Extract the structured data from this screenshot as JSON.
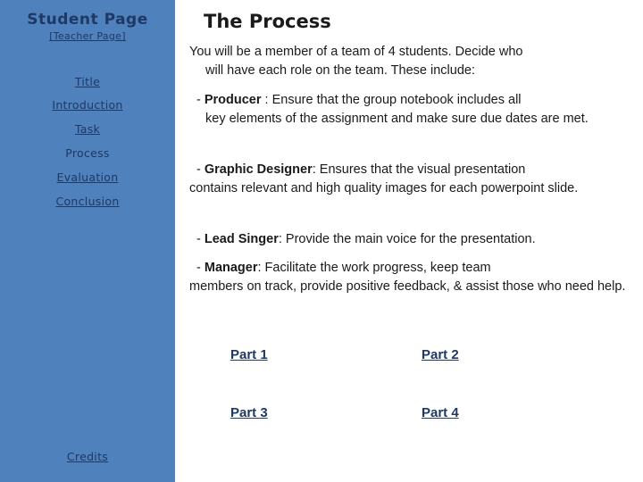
{
  "sidebar": {
    "title": "Student Page",
    "teacher_link": {
      "open_bracket": "[",
      "label": "Teacher Page",
      "close_bracket": "]"
    },
    "nav": [
      {
        "label": "Title",
        "current": false
      },
      {
        "label": "Introduction",
        "current": false
      },
      {
        "label": "Task",
        "current": false
      },
      {
        "label": "Process",
        "current": true
      },
      {
        "label": "Evaluation",
        "current": false
      },
      {
        "label": "Conclusion",
        "current": false
      }
    ],
    "credits_label": "Credits",
    "background_color": "#4f81bd",
    "text_color": "#1f3864"
  },
  "main": {
    "title": "The Process",
    "intro": {
      "line1": "You will be a member of a team of 4 students. Decide who",
      "line2": "will have each role on the team. These include:"
    },
    "roles": [
      {
        "dash": "- ",
        "name": "Producer",
        "lead_text": " : Ensure that the group notebook includes all",
        "rest": "key elements of the assignment and make sure due dates are met."
      },
      {
        "dash": "- ",
        "name": "Graphic Designer",
        "lead_text": ": Ensures that the visual presentation",
        "rest": "contains relevant and high quality images for each powerpoint slide."
      },
      {
        "dash": "- ",
        "name": "Lead Singer",
        "lead_text": ": Provide the main voice for the presentation.",
        "rest": ""
      },
      {
        "dash": "- ",
        "name": "Manager",
        "lead_text": ": Facilitate the work progress, keep team",
        "rest": "members on track, provide positive feedback, & assist those who need help."
      }
    ],
    "parts": [
      {
        "label": "Part 1 "
      },
      {
        "label": "Part 2"
      },
      {
        "label": "Part 3 "
      },
      {
        "label": "Part 4"
      }
    ]
  }
}
